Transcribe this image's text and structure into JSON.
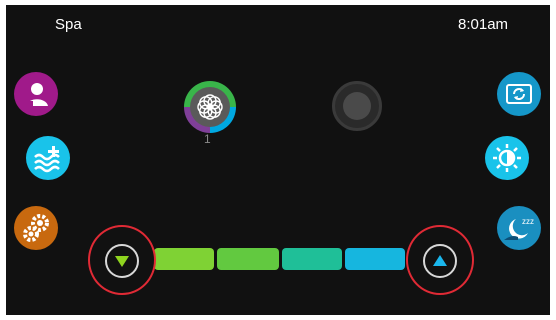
{
  "header": {
    "title": "Spa",
    "clock": "8:01am"
  },
  "left_buttons": [
    {
      "icon": "profile-icon",
      "color": "#a01a8a"
    },
    {
      "icon": "water-temp-plus-icon",
      "color": "#19c3ea"
    },
    {
      "icon": "gears-icon",
      "color": "#c8690f"
    }
  ],
  "right_buttons": [
    {
      "icon": "cycle-icon",
      "color": "#1597c9"
    },
    {
      "icon": "brightness-icon",
      "color": "#19c3ea"
    },
    {
      "icon": "night-mode-icon",
      "color": "#1a8fc0"
    }
  ],
  "modes": [
    {
      "icon": "color-wheel-icon",
      "label": "1",
      "selected": true
    },
    {
      "icon": "empty-mode-icon",
      "label": "",
      "selected": false
    }
  ],
  "level": {
    "segments": 4,
    "filled": 4,
    "colors": [
      "#7fd234",
      "#62c940",
      "#1fbf98",
      "#16b6df"
    ]
  },
  "colors": {
    "background": "#111111",
    "highlight_ring": "#e02a35",
    "down_arrow": "#8fd41f",
    "up_arrow": "#1ab6ec"
  }
}
